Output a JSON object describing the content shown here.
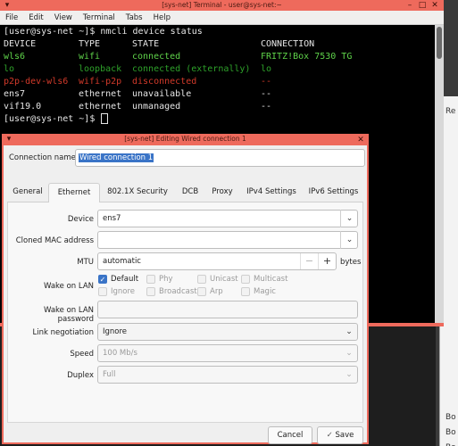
{
  "terminal": {
    "title": "[sys-net] Terminal - user@sys-net:~",
    "menu": [
      "File",
      "Edit",
      "View",
      "Terminal",
      "Tabs",
      "Help"
    ],
    "prompt": "[user@sys-net ~]$ ",
    "command": "nmcli device status",
    "headers": [
      "DEVICE",
      "TYPE",
      "STATE",
      "CONNECTION"
    ],
    "rows": [
      [
        "wls6",
        "wifi",
        "connected",
        "FRITZ!Box 7530 TG"
      ],
      [
        "lo",
        "loopback",
        "connected (externally)",
        "lo"
      ],
      [
        "p2p-dev-wls6",
        "wifi-p2p",
        "disconnected",
        "--"
      ],
      [
        "ens7",
        "ethernet",
        "unavailable",
        "--"
      ],
      [
        "vif19.0",
        "ethernet",
        "unmanaged",
        "--"
      ]
    ]
  },
  "dialog": {
    "title": "[sys-net] Editing Wired connection 1",
    "connection_name_label": "Connection name",
    "connection_name_value": "Wired connection 1",
    "tabs": [
      "General",
      "Ethernet",
      "802.1X Security",
      "DCB",
      "Proxy",
      "IPv4 Settings",
      "IPv6 Settings"
    ],
    "active_tab": "Ethernet",
    "device_label": "Device",
    "device_value": "ens7",
    "cloned_mac_label": "Cloned MAC address",
    "cloned_mac_value": "",
    "mtu_label": "MTU",
    "mtu_value": "automatic",
    "mtu_minus": "−",
    "mtu_plus": "+",
    "mtu_unit": "bytes",
    "wol_label": "Wake on LAN",
    "wol_options": [
      "Default",
      "Phy",
      "Unicast",
      "Multicast",
      "Ignore",
      "Broadcast",
      "Arp",
      "Magic"
    ],
    "wol_password_label": "Wake on LAN password",
    "wol_password_value": "",
    "link_neg_label": "Link negotiation",
    "link_neg_value": "Ignore",
    "speed_label": "Speed",
    "speed_value": "100 Mb/s",
    "duplex_label": "Duplex",
    "duplex_value": "Full",
    "cancel_label": "Cancel",
    "save_label": "Save"
  },
  "background": {
    "texts": [
      "Re",
      "Bo",
      "Bo",
      "Bo"
    ]
  }
}
